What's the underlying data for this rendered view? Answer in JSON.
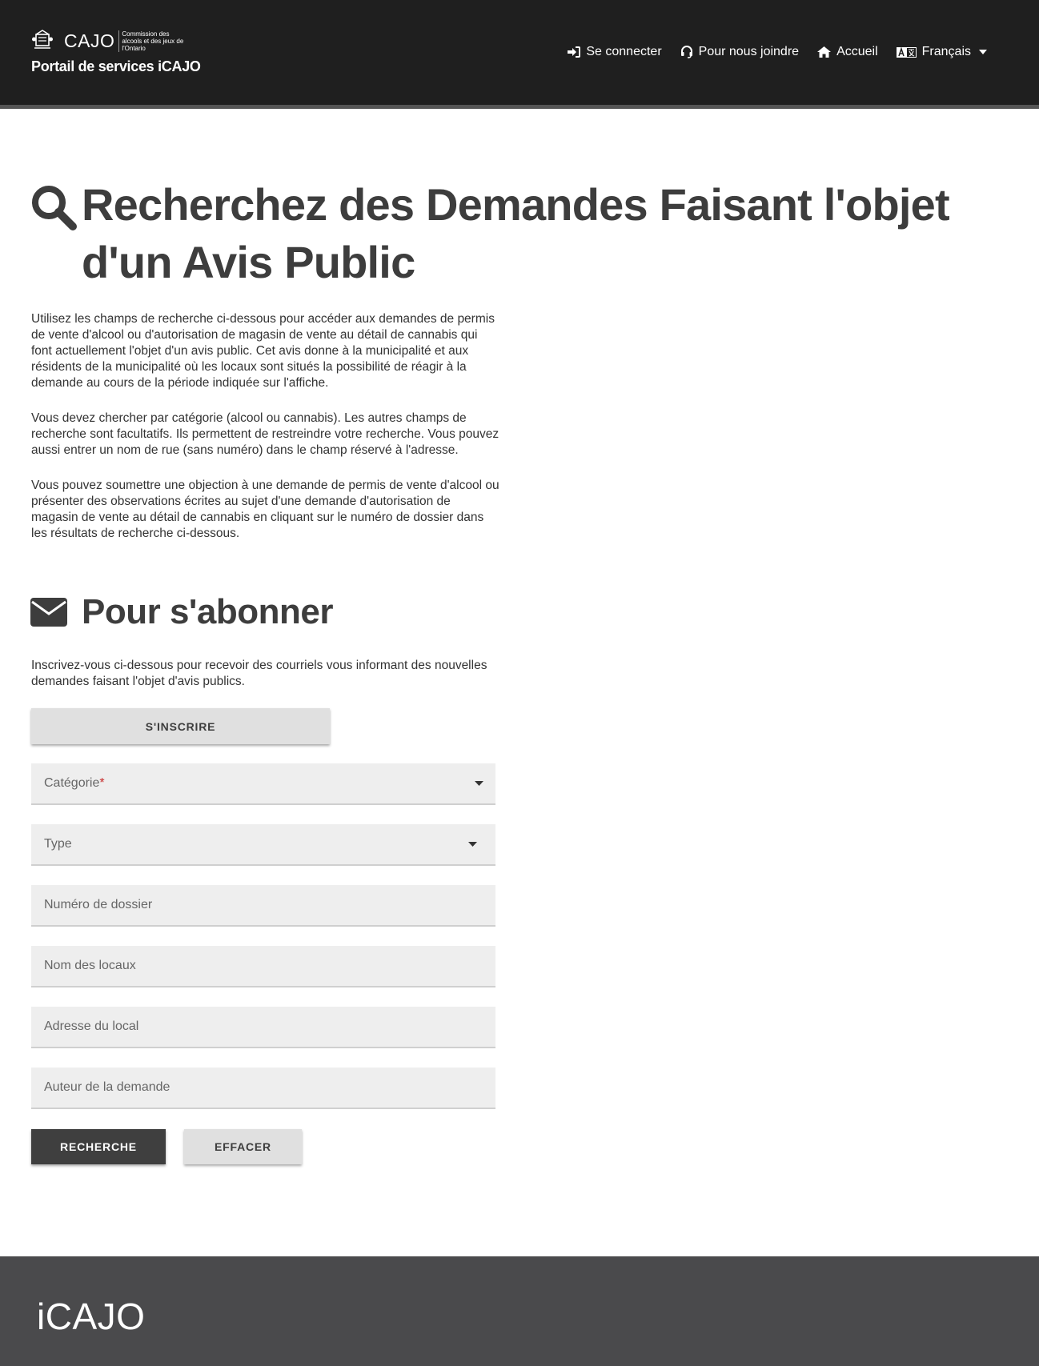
{
  "header": {
    "brand": "CAJO",
    "brand_sub": "Commission des alcools et des jeux de l'Ontario",
    "portal_name": "Portail de services iCAJO",
    "nav": {
      "login": "Se connecter",
      "contact": "Pour nous joindre",
      "home": "Accueil",
      "language": "Français"
    }
  },
  "main": {
    "title": "Recherchez des Demandes Faisant l'objet d'un Avis Public",
    "intro": [
      "Utilisez les champs de recherche ci-dessous pour accéder aux demandes de permis de vente d'alcool ou d'autorisation de magasin de vente au détail de cannabis qui font actuellement l'objet d'un avis public. Cet avis donne à la municipalité et aux résidents de la municipalité où les locaux sont situés la possibilité de réagir à la demande au cours de la période indiquée sur l'affiche.",
      "Vous devez chercher par catégorie (alcool ou cannabis). Les autres champs de recherche sont facultatifs. Ils permettent de restreindre votre recherche. Vous pouvez aussi entrer un nom de rue (sans numéro) dans le champ réservé à l'adresse.",
      "Vous pouvez soumettre une objection à une demande de permis de vente d'alcool ou présenter des observations écrites au sujet d'une demande d'autorisation de magasin de vente au détail de cannabis en cliquant sur le numéro de dossier dans les résultats de recherche ci-dessous."
    ],
    "subscribe": {
      "title": "Pour s'abonner",
      "description": "Inscrivez-vous ci-dessous pour recevoir des courriels vous informant des nouvelles demandes faisant l'objet d'avis publics.",
      "button": "S'inscrire"
    },
    "form": {
      "category_label": "Catégorie",
      "required_mark": "*",
      "type_label": "Type",
      "file_number_label": "Numéro de dossier",
      "premises_name_label": "Nom des locaux",
      "premises_address_label": "Adresse du local",
      "applicant_label": "Auteur de la demande",
      "search_button": "Recherche",
      "clear_button": "Effacer"
    }
  },
  "footer": {
    "logo": "iCAJO"
  },
  "colors": {
    "header_bg": "#1f1f1f",
    "footer_bg": "#4a4a4c",
    "text_dark": "#3d3d3d",
    "field_bg": "#eeeeee",
    "required": "#c62828"
  }
}
